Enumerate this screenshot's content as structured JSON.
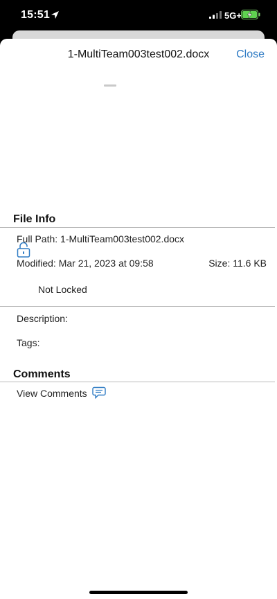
{
  "status_bar": {
    "time": "15:51",
    "network": "5G+",
    "icons": [
      "location-arrow-icon",
      "signal-icon",
      "battery-charging-icon"
    ]
  },
  "header": {
    "title": "1-MultiTeam003test002.docx",
    "close_label": "Close"
  },
  "file_info": {
    "section_title": "File Info",
    "full_path": "Full Path: 1-MultiTeam003test002.docx",
    "modified": "Modified: Mar 21, 2023 at 09:58",
    "size": "Size: 11.6 KB",
    "lock_status": "Not Locked",
    "lock_icon": "unlocked-padlock-icon",
    "description_label": "Description:",
    "tags_label": "Tags:"
  },
  "comments": {
    "section_title": "Comments",
    "view_label": "View Comments",
    "icon": "speech-bubble-icon"
  },
  "colors": {
    "accent": "#2e7bc4",
    "divider": "#b9b9b9",
    "backdrop": "#d8d8d8"
  }
}
